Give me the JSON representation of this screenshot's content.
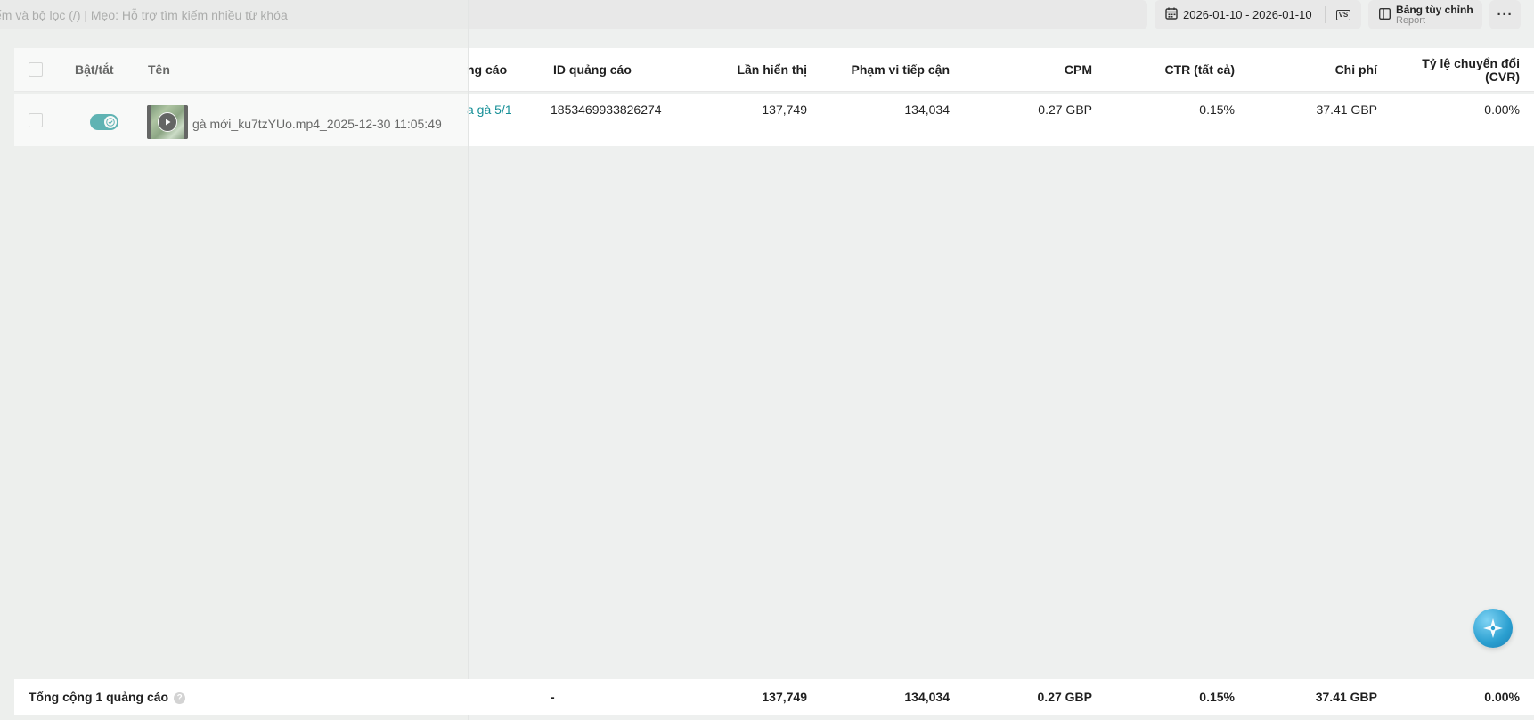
{
  "search": {
    "placeholder": "ếm và bộ lọc (/) | Mẹo: Hỗ trợ tìm kiếm nhiều từ khóa"
  },
  "toolbar": {
    "date_range": "2026-01-10 - 2026-01-10",
    "compare_label": "VS",
    "custom_table_title": "Bảng tùy chỉnh",
    "custom_table_sub": "Report",
    "more_label": "···"
  },
  "table": {
    "headers": {
      "toggle": "Bật/tắt",
      "name": "Tên",
      "ad_group": "ng cáo",
      "ad_id": "ID quảng cáo",
      "impressions": "Lần hiển thị",
      "reach": "Phạm vi tiếp cận",
      "cpm": "CPM",
      "ctr": "CTR (tất cả)",
      "cost": "Chi phí",
      "cvr_line1": "Tỷ lệ chuyển đổi",
      "cvr_line2": "(CVR)"
    },
    "rows": [
      {
        "enabled": true,
        "name": "gà mới_ku7tzYUo.mp4_2025-12-30 11:05:49",
        "ad_group": "a gà 5/1",
        "ad_id": "1853469933826274",
        "impressions": "137,749",
        "reach": "134,034",
        "cpm": "0.27 GBP",
        "ctr": "0.15%",
        "cost": "37.41 GBP",
        "cvr": "0.00%"
      }
    ],
    "footer": {
      "label": "Tổng cộng 1 quảng cáo",
      "help": "?",
      "ad_id": "-",
      "impressions": "137,749",
      "reach": "134,034",
      "cpm": "0.27 GBP",
      "ctr": "0.15%",
      "cost": "37.41 GBP",
      "cvr": "0.00%"
    }
  },
  "colors": {
    "accent": "#149496",
    "link": "#168f97",
    "background": "#eef0ef"
  },
  "icons": [
    "calendar-icon",
    "vs-icon",
    "columns-icon",
    "more-icon",
    "check-icon",
    "play-icon",
    "assistant-icon",
    "help-icon"
  ]
}
